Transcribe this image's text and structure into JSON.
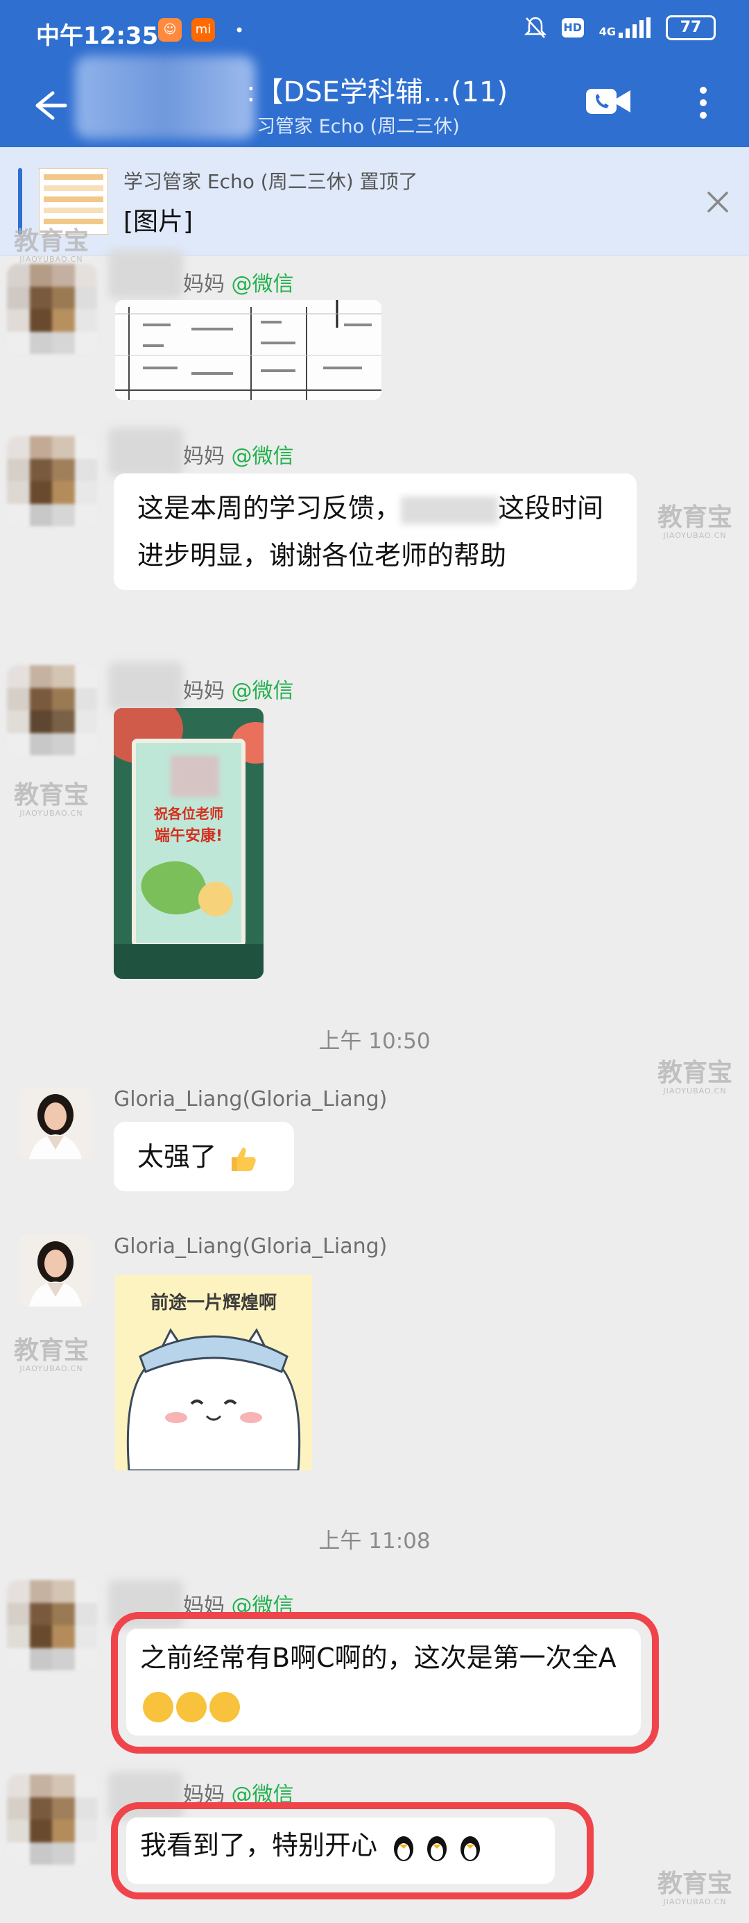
{
  "status_bar": {
    "time": "中午12:35",
    "network": "4G",
    "battery": "77"
  },
  "header": {
    "title": ":【DSE学科辅…(11)",
    "subtitle": "习管家 Echo (周二三休)"
  },
  "pinned": {
    "title": "学习管家 Echo (周二三休) 置顶了",
    "body": "[图片]"
  },
  "messages": {
    "m1": {
      "sender": "妈妈",
      "source": "@微信"
    },
    "m2": {
      "sender": "妈妈",
      "source": "@微信",
      "text_a": "这是本周的学习反馈，",
      "text_b": "这段时间进步明显，谢谢各位老师的帮助"
    },
    "m3": {
      "sender": "妈妈",
      "source": "@微信",
      "card_line1": "祝各位老师",
      "card_line2": "端午安康!"
    },
    "ts1": "上午 10:50",
    "m4": {
      "sender": "Gloria_Liang(Gloria_Liang)",
      "text": "太强了"
    },
    "m5": {
      "sender": "Gloria_Liang(Gloria_Liang)",
      "sticker_text": "前途一片辉煌啊"
    },
    "ts2": "上午 11:08",
    "m6": {
      "sender": "妈妈",
      "source": "@微信",
      "text": "之前经常有B啊C啊的，这次是第一次全A"
    },
    "m7": {
      "sender": "妈妈",
      "source": "@微信",
      "text": "我看到了，特别开心"
    }
  },
  "watermark": {
    "text": "教育宝",
    "sub": "JIAOYUBAO.CN"
  },
  "colors": {
    "header": "#2f6fd0",
    "wechat_green": "#22b14c",
    "highlight_red": "#f0444b"
  }
}
